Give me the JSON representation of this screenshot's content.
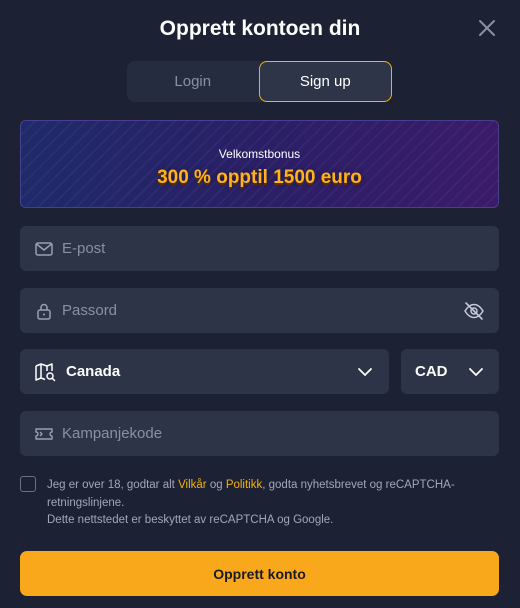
{
  "modal": {
    "title": "Opprett kontoen din"
  },
  "tabs": {
    "login": "Login",
    "signup": "Sign up"
  },
  "bonus": {
    "subtitle": "Velkomstbonus",
    "headline": "300 % opptil 1500 euro"
  },
  "form": {
    "email_placeholder": "E-post",
    "password_placeholder": "Passord",
    "country_value": "Canada",
    "currency_value": "CAD",
    "promo_placeholder": "Kampanjekode"
  },
  "terms": {
    "prefix": "Jeg er over 18, godtar alt ",
    "terms_link": "Vilkår",
    "and": " og ",
    "policy_link": "Politikk",
    "suffix": ", godta nyhetsbrevet og reCAPTCHA-retningslinjene.",
    "checked": false
  },
  "captcha_note": "Dette nettstedet er beskyttet av reCAPTCHA og Google.",
  "submit_label": "Opprett konto",
  "colors": {
    "background": "#1c2134",
    "field": "#2d3448",
    "accent": "#f4b400",
    "button": "#f9a81b"
  },
  "icons": [
    "close-icon",
    "mail-icon",
    "lock-icon",
    "eye-off-icon",
    "map-search-icon",
    "chevron-down-icon",
    "ticket-icon"
  ]
}
